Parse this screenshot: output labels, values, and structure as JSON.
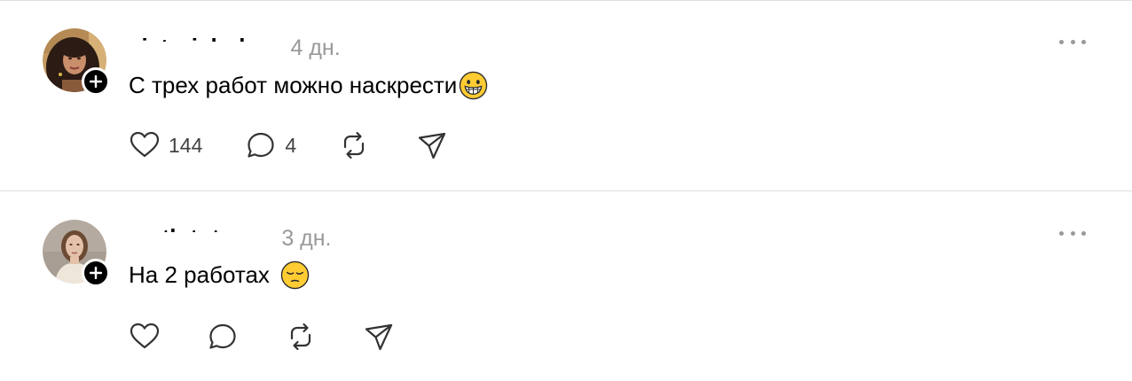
{
  "posts": [
    {
      "username": "victoriabuben",
      "timestamp": "4 дн.",
      "text": "С трех работ можно наскрести",
      "emoji": "grinning-face-emoji",
      "likes": "144",
      "replies": "4"
    },
    {
      "username": "math.tutoron",
      "timestamp": "3 дн.",
      "text": "На 2 работах",
      "emoji": "pensive-face-emoji",
      "likes": "",
      "replies": ""
    }
  ],
  "icons": {
    "like": "heart-icon",
    "reply": "comment-bubble-icon",
    "repost": "repost-arrows-icon",
    "share": "send-paper-plane-icon",
    "more": "more-dots-icon",
    "follow": "plus-icon"
  },
  "colors": {
    "text": "#000000",
    "muted": "#999999",
    "icon": "#333333",
    "divider": "#e0e0e0",
    "badge": "#000000"
  }
}
